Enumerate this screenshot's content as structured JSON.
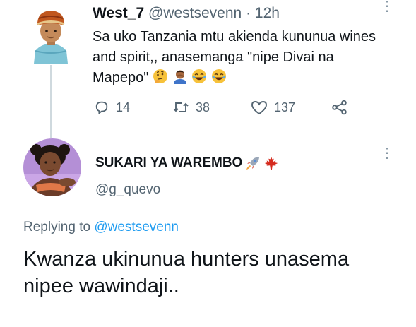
{
  "tweet": {
    "author_name": "West_7",
    "author_handle": "@westsevenn",
    "time": "· 12h",
    "text": "Sa uko Tanzania mtu akienda kununua wines and spirit,, anasemanga \"nipe Divai na Mapepo\"",
    "emojis": [
      "thinking-face",
      "person-facepalming",
      "face-with-tears-of-joy",
      "face-with-tears-of-joy"
    ],
    "stats": {
      "replies": "14",
      "retweets": "38",
      "likes": "137"
    }
  },
  "reply": {
    "author_name": "SUKARI YA WAREMBO",
    "author_emojis": [
      "rocket",
      "maple-leaf"
    ],
    "author_handle": "@g_quevo",
    "replying_prefix": "Replying to",
    "replying_to": "@westsevenn",
    "text": "Kwanza ukinunua hunters unasema nipee wawindaji.."
  },
  "colors": {
    "text": "#0f1419",
    "secondary": "#536471",
    "link": "#1d9bf0",
    "thread_line": "#cfd9de"
  }
}
